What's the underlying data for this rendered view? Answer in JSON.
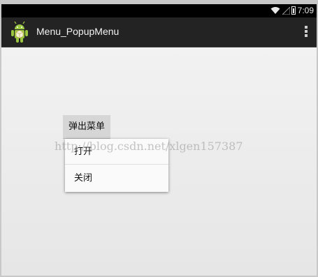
{
  "status_bar": {
    "time": "7:09",
    "icons": [
      "wifi-icon",
      "signal-icon",
      "battery-icon"
    ]
  },
  "action_bar": {
    "app_icon": "android-icon",
    "title": "Menu_PopupMenu",
    "overflow_icon": "overflow-menu-icon"
  },
  "main": {
    "popup_button_label": "弹出菜单"
  },
  "popup_menu": {
    "items": [
      {
        "label": "打开"
      },
      {
        "label": "关闭"
      }
    ]
  },
  "watermark": {
    "text": "http://blog.csdn.net/xlgen157387"
  },
  "colors": {
    "action_bar": "#232323",
    "status_bar": "#000000",
    "android_green": "#9bc740"
  }
}
